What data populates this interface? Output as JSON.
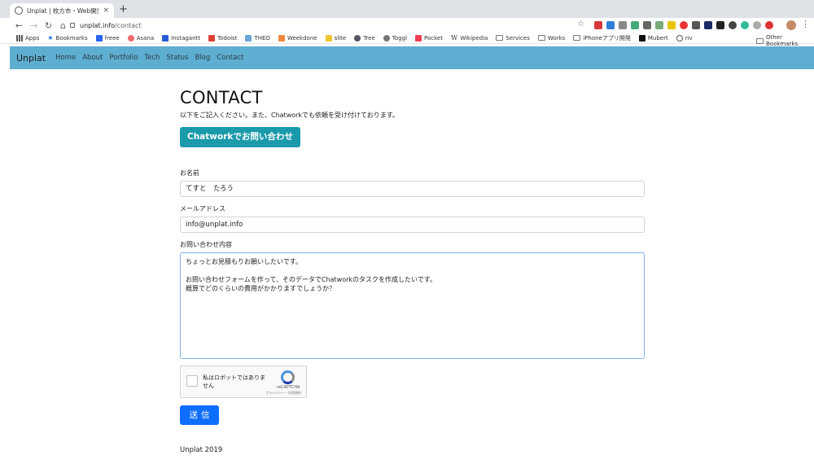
{
  "browser": {
    "tab_title": "Unplat | 枚方市・Web開発・アプ",
    "new_tab": "+",
    "close_tab": "×",
    "url_host": "unplat.info",
    "url_path": "/contact",
    "bookmarks": [
      "Apps",
      "Bookmarks",
      "freee",
      "Asana",
      "Instagantt",
      "Todoist",
      "THEO",
      "Weekdone",
      "slite",
      "Tree",
      "Toggl",
      "Pocket",
      "Wikipedia",
      "Services",
      "Works",
      "iPhoneアプリ開発",
      "Mubert",
      "riv"
    ],
    "other_bookmarks": "Other Bookmarks"
  },
  "site": {
    "brand": "Unplat",
    "nav": [
      "Home",
      "About",
      "Portfolio",
      "Tech",
      "Status",
      "Blog",
      "Contact"
    ],
    "nav_color": "#5eaed1"
  },
  "page": {
    "title": "CONTACT",
    "lead": "以下をご記入ください。また、Chatworkでも依頼を受け付けております。",
    "chatwork_button": "Chatworkでお問い合わせ",
    "name_label": "お名前",
    "name_value": "てすと　たろう",
    "email_label": "メールアドレス",
    "email_value": "info@unplat.info",
    "message_label": "お問い合わせ内容",
    "message_value": "ちょっとお見積もりお願いしたいです。\n\nお問い合わせフォームを作って、そのデータでChatworkのタスクを作成したいです。\n概算でどのくらいの費用がかかりますでしょうか？",
    "recaptcha_text": "私はロボットではありません",
    "recaptcha_brand": "reCAPTCHA",
    "recaptcha_terms": "プライバシー - 利用規約",
    "submit": "送信",
    "footer": "Unplat 2019"
  }
}
